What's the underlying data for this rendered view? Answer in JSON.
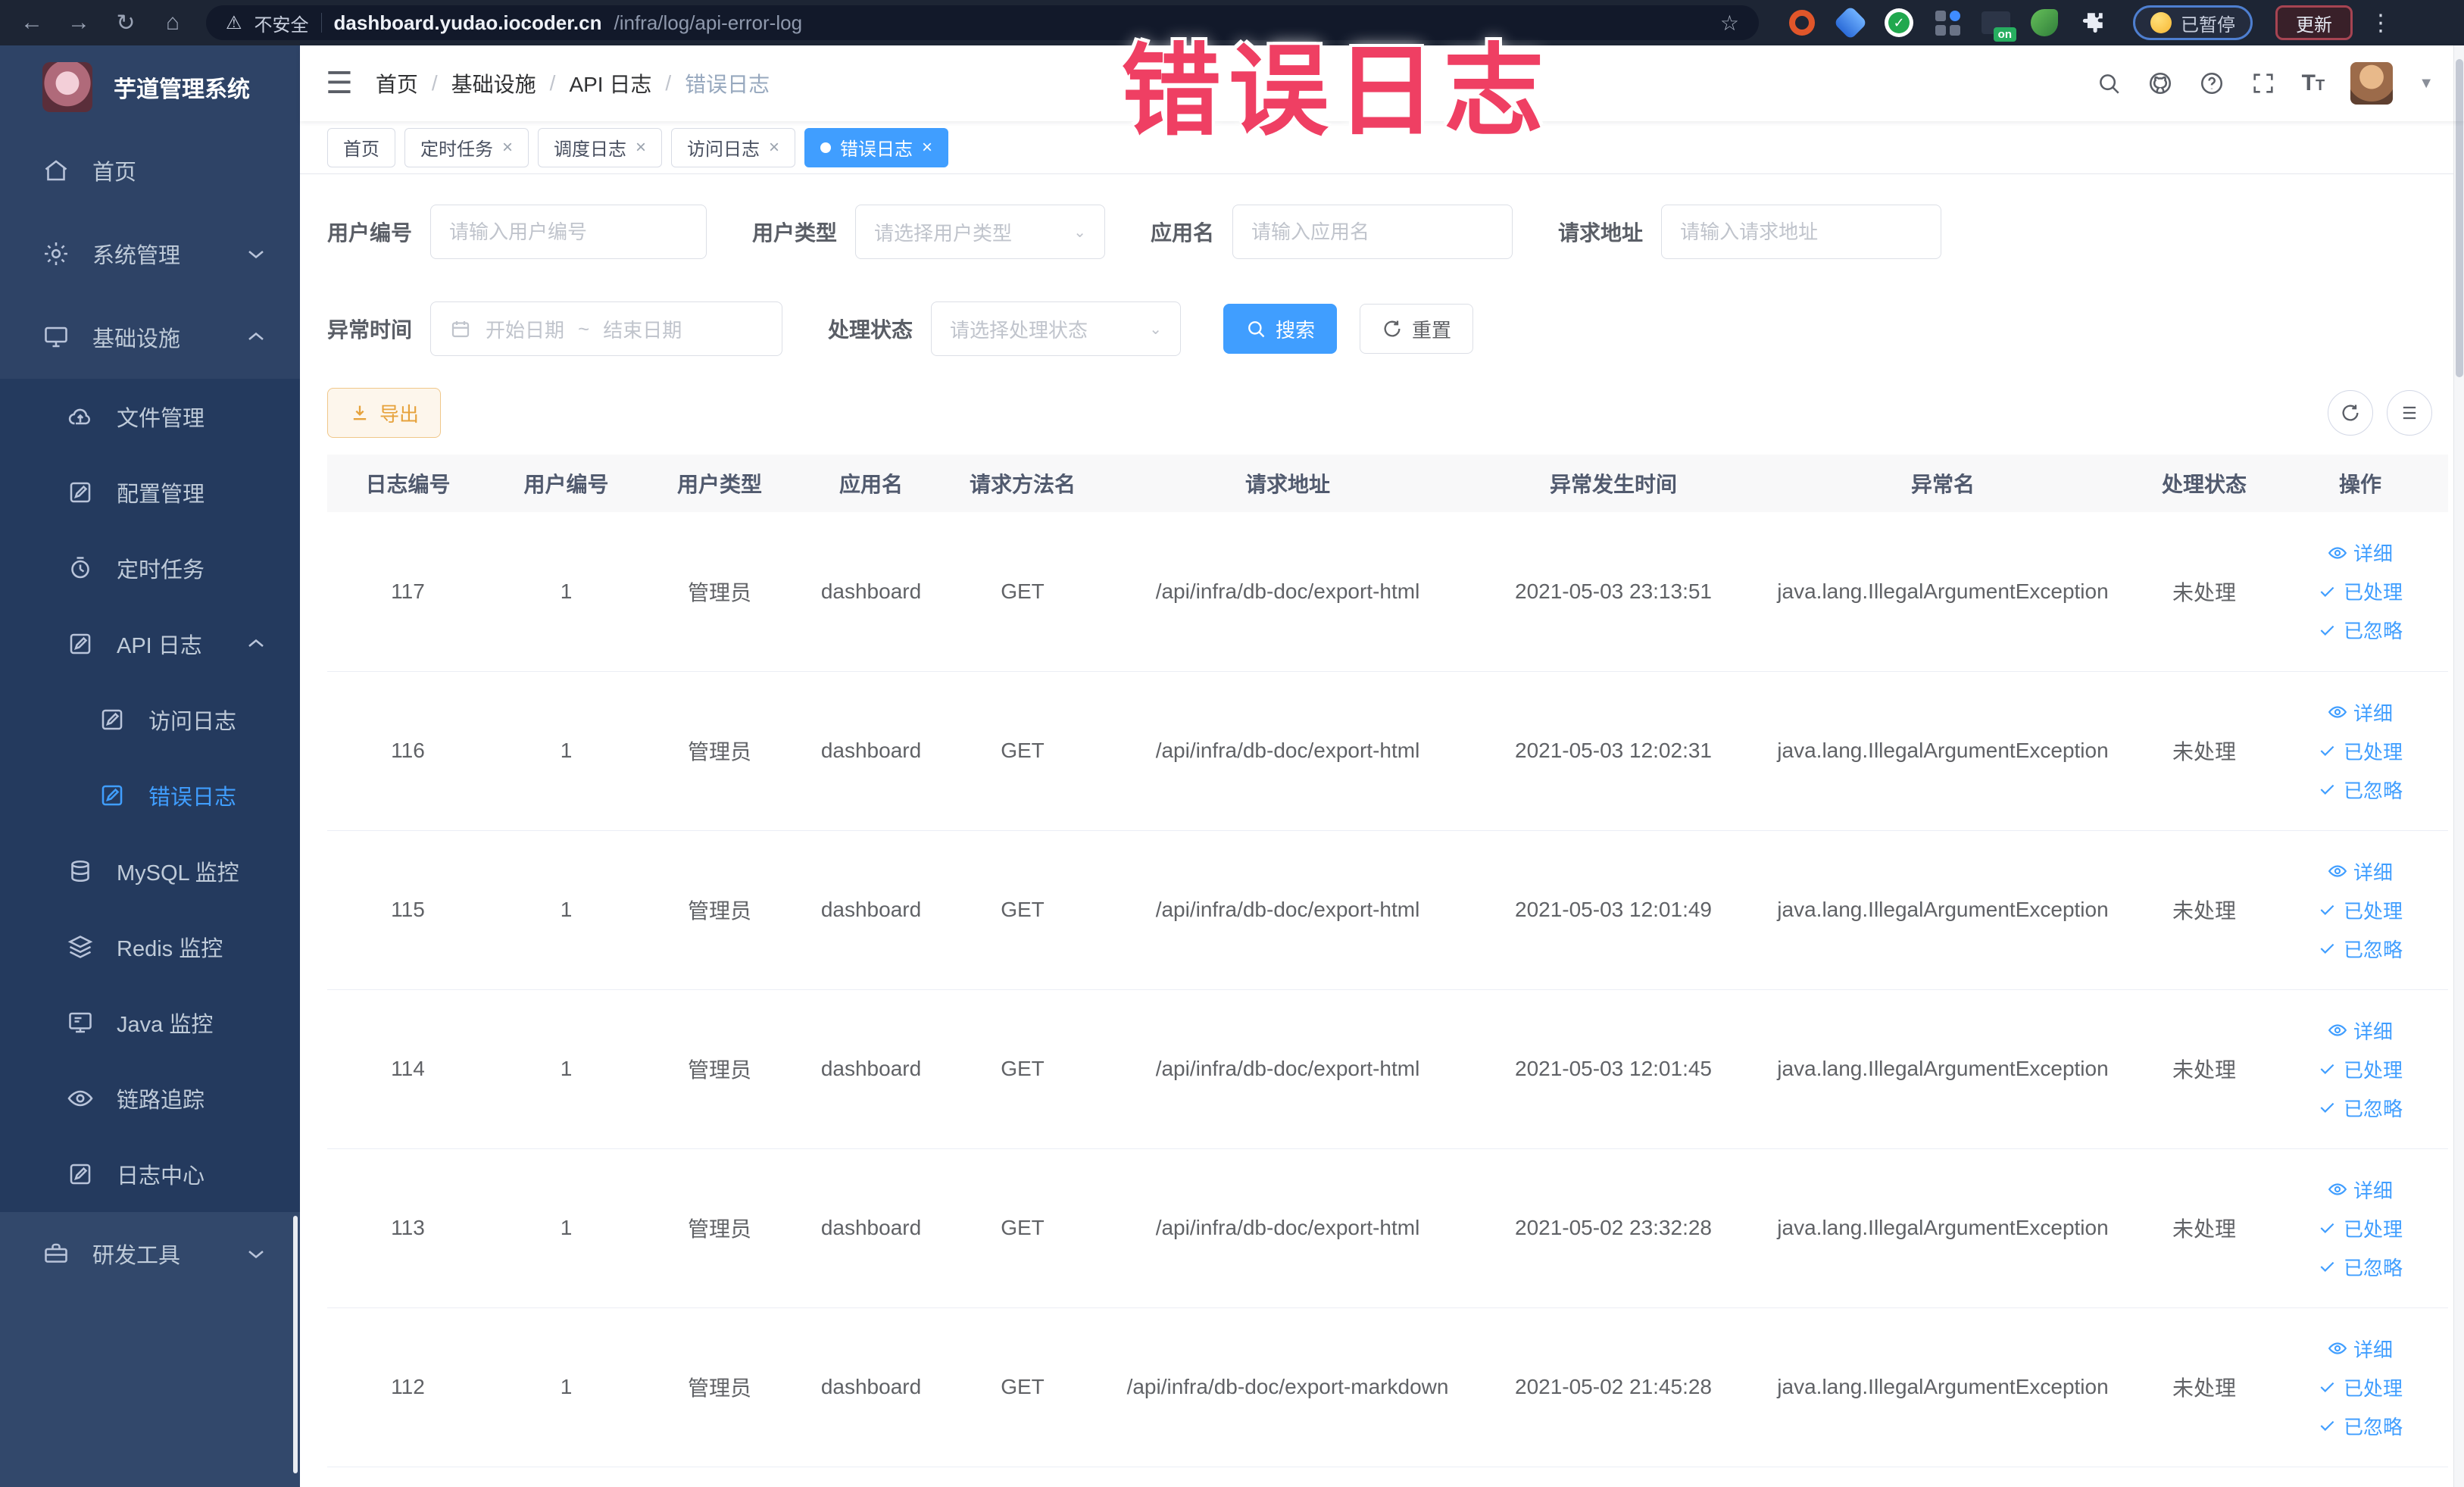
{
  "browser": {
    "security_label": "不安全",
    "url_host": "dashboard.yudao.iocoder.cn",
    "url_path": "/infra/log/api-error-log",
    "paused_badge": "已暂停",
    "update_button": "更新",
    "nav": {
      "back": "←",
      "forward": "→",
      "reload": "↻",
      "home": "⌂",
      "warning": "⚠",
      "star": "☆",
      "menu": "⋮",
      "on_badge": "on",
      "green_check": "✓"
    }
  },
  "annotation": "错误日志",
  "sidebar": {
    "logo_title": "芋道管理系统",
    "home": "首页",
    "system": "系统管理",
    "infra": "基础设施",
    "file": "文件管理",
    "config": "配置管理",
    "job": "定时任务",
    "api_log": "API 日志",
    "access_log": "访问日志",
    "error_log": "错误日志",
    "mysql": "MySQL 监控",
    "redis": "Redis 监控",
    "java": "Java 监控",
    "trace": "链路追踪",
    "log_center": "日志中心",
    "dev_tools": "研发工具"
  },
  "header": {
    "breadcrumb": [
      "首页",
      "基础设施",
      "API 日志",
      "错误日志"
    ],
    "separator": "/"
  },
  "tabs": [
    {
      "label": "首页"
    },
    {
      "label": "定时任务",
      "close": "×"
    },
    {
      "label": "调度日志",
      "close": "×"
    },
    {
      "label": "访问日志",
      "close": "×"
    },
    {
      "label": "错误日志",
      "close": "×"
    }
  ],
  "filters": {
    "user_id": {
      "label": "用户编号",
      "placeholder": "请输入用户编号"
    },
    "user_type": {
      "label": "用户类型",
      "placeholder": "请选择用户类型"
    },
    "app_name": {
      "label": "应用名",
      "placeholder": "请输入应用名"
    },
    "request_url": {
      "label": "请求地址",
      "placeholder": "请输入请求地址"
    },
    "exception_time": {
      "label": "异常时间",
      "start_placeholder": "开始日期",
      "separator": "~",
      "end_placeholder": "结束日期"
    },
    "process_status": {
      "label": "处理状态",
      "placeholder": "请选择处理状态"
    },
    "search_button": "搜索",
    "reset_button": "重置",
    "caret": "⌄"
  },
  "toolbar": {
    "export_button": "导出"
  },
  "table": {
    "columns": [
      "日志编号",
      "用户编号",
      "用户类型",
      "应用名",
      "请求方法名",
      "请求地址",
      "异常发生时间",
      "异常名",
      "处理状态",
      "操作"
    ],
    "actions": [
      "详细",
      "已处理",
      "已忽略"
    ],
    "rows": [
      {
        "id": "117",
        "user_id": "1",
        "user_type": "管理员",
        "app": "dashboard",
        "method": "GET",
        "url": "/api/infra/db-doc/export-html",
        "time": "2021-05-03 23:13:51",
        "exception": "java.lang.IllegalArgumentException",
        "status": "未处理"
      },
      {
        "id": "116",
        "user_id": "1",
        "user_type": "管理员",
        "app": "dashboard",
        "method": "GET",
        "url": "/api/infra/db-doc/export-html",
        "time": "2021-05-03 12:02:31",
        "exception": "java.lang.IllegalArgumentException",
        "status": "未处理"
      },
      {
        "id": "115",
        "user_id": "1",
        "user_type": "管理员",
        "app": "dashboard",
        "method": "GET",
        "url": "/api/infra/db-doc/export-html",
        "time": "2021-05-03 12:01:49",
        "exception": "java.lang.IllegalArgumentException",
        "status": "未处理"
      },
      {
        "id": "114",
        "user_id": "1",
        "user_type": "管理员",
        "app": "dashboard",
        "method": "GET",
        "url": "/api/infra/db-doc/export-html",
        "time": "2021-05-03 12:01:45",
        "exception": "java.lang.IllegalArgumentException",
        "status": "未处理"
      },
      {
        "id": "113",
        "user_id": "1",
        "user_type": "管理员",
        "app": "dashboard",
        "method": "GET",
        "url": "/api/infra/db-doc/export-html",
        "time": "2021-05-02 23:32:28",
        "exception": "java.lang.IllegalArgumentException",
        "status": "未处理"
      },
      {
        "id": "112",
        "user_id": "1",
        "user_type": "管理员",
        "app": "dashboard",
        "method": "GET",
        "url": "/api/infra/db-doc/export-markdown",
        "time": "2021-05-02 21:45:28",
        "exception": "java.lang.IllegalArgumentException",
        "status": "未处理"
      }
    ]
  },
  "colors": {
    "accent": "#409eff",
    "annotation_red": "#ef3f63",
    "warning_orange": "#e6a23c",
    "sidebar_bg": "#2e4366",
    "chrome_bg": "#1d2534"
  }
}
